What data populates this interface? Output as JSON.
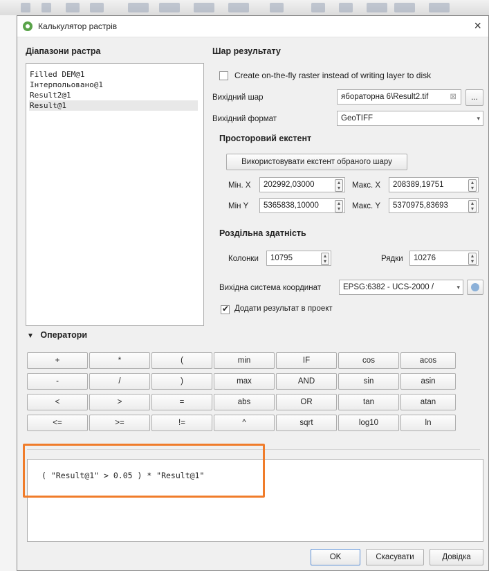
{
  "dialog": {
    "title": "Калькулятор растрів",
    "close_glyph": "×"
  },
  "raster_bands": {
    "heading": "Діапазони растра",
    "items": [
      "Filled DEM@1",
      "Інтерпольовано@1",
      "Result2@1",
      "Result@1"
    ],
    "selected_index": 3
  },
  "result_layer": {
    "heading": "Шар результату",
    "on_the_fly_label": "Create on-the-fly raster instead of writing layer to disk",
    "on_the_fly_checked": false,
    "output_layer_label": "Вихідний шар",
    "output_layer_value": "ябораторна 6\\Result2.tif",
    "browse_label": "...",
    "output_format_label": "Вихідний формат",
    "output_format_value": "GeoTIFF"
  },
  "extent": {
    "heading": "Просторовий екстент",
    "use_selected_button": "Використовувати екстент обраного шару",
    "xmin_label": "Мін. X",
    "xmin_value": "202992,03000",
    "xmax_label": "Макс. X",
    "xmax_value": "208389,19751",
    "ymin_label": "Мін Y",
    "ymin_value": "5365838,10000",
    "ymax_label": "Макс. Y",
    "ymax_value": "5370975,83693"
  },
  "resolution": {
    "heading": "Роздільна здатність",
    "columns_label": "Колонки",
    "columns_value": "10795",
    "rows_label": "Рядки",
    "rows_value": "10276"
  },
  "crs": {
    "label": "Вихідна система координат",
    "value": "EPSG:6382 - UCS-2000 /"
  },
  "add_to_project": {
    "label": "Додати результат в проект",
    "checked": true
  },
  "operators": {
    "heading": "Оператори",
    "rows": [
      [
        "+",
        "*",
        "(",
        "min",
        "IF",
        "cos",
        "acos"
      ],
      [
        "-",
        "/",
        ")",
        "max",
        "AND",
        "sin",
        "asin"
      ],
      [
        "<",
        ">",
        "=",
        "abs",
        "OR",
        "tan",
        "atan"
      ],
      [
        "<=",
        ">=",
        "!=",
        "^",
        "sqrt",
        "log10",
        "ln"
      ]
    ]
  },
  "expression": {
    "text": "( \"Result@1\" > 0.05 ) * \"Result@1\""
  },
  "buttons": {
    "ok": "OK",
    "cancel": "Скасувати",
    "help": "Довідка"
  },
  "colors": {
    "highlight_border": "#f07c2a",
    "qgis_icon": "#5aa34a"
  }
}
